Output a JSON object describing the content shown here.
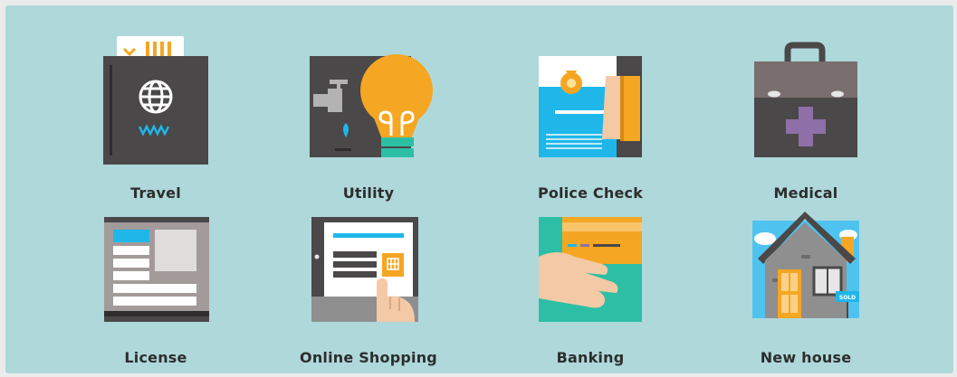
{
  "categories": [
    {
      "id": "travel",
      "label": "Travel",
      "icon": "passport-icon"
    },
    {
      "id": "utility",
      "label": "Utility",
      "icon": "lightbulb-tap-icon"
    },
    {
      "id": "police-check",
      "label": "Police Check",
      "icon": "police-certificate-icon"
    },
    {
      "id": "medical",
      "label": "Medical",
      "icon": "medical-bag-icon"
    },
    {
      "id": "license",
      "label": "License",
      "icon": "license-card-icon"
    },
    {
      "id": "online-shopping",
      "label": "Online Shopping",
      "icon": "tablet-shopping-icon"
    },
    {
      "id": "banking",
      "label": "Banking",
      "icon": "card-hand-icon"
    },
    {
      "id": "new-house",
      "label": "New house",
      "icon": "house-sold-icon"
    }
  ],
  "badges": {
    "sold": "SOLD"
  },
  "colors": {
    "background": "#afd8db",
    "dark": "#4a4848",
    "orange": "#f5a623",
    "blue": "#1fb7ea",
    "teal": "#2dbfa6",
    "skin": "#f4c9a6",
    "purple": "#8e6fa8"
  }
}
